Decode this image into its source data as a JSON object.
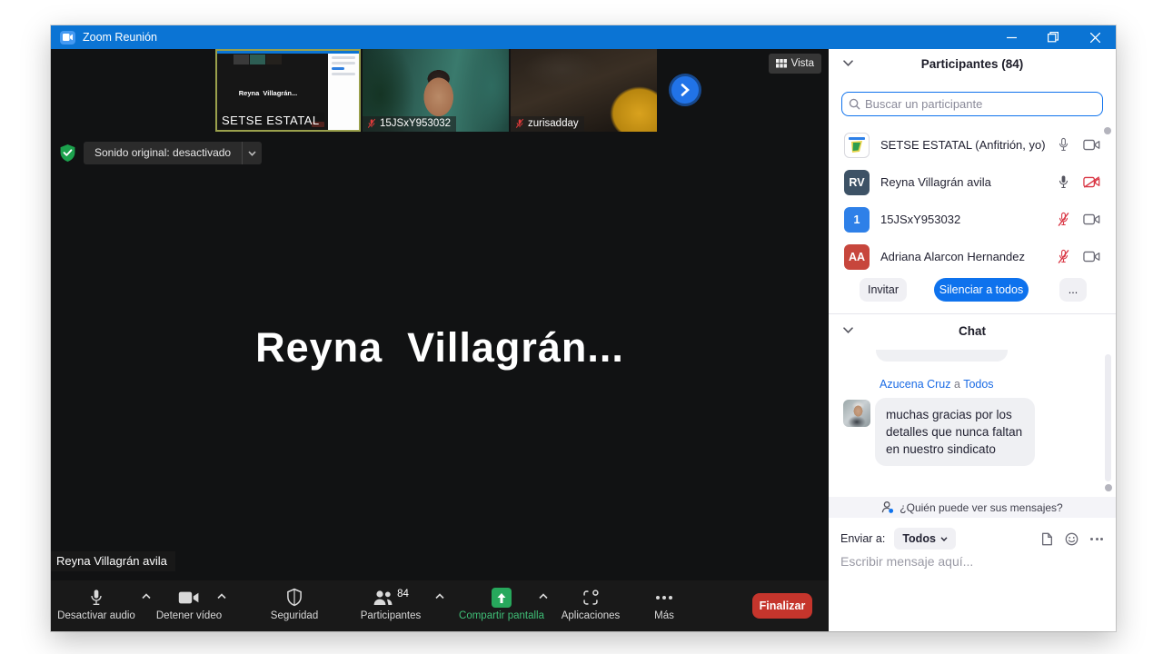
{
  "window": {
    "title": "Zoom Reunión"
  },
  "filmstrip": {
    "view_button": "Vista",
    "thumbnails": [
      {
        "label": "SETSE ESTATAL",
        "preview_name": "Reyna  Villagrán...",
        "muted": false
      },
      {
        "label": "15JSxY953032",
        "muted": true
      },
      {
        "label": "zurisadday",
        "muted": true
      }
    ]
  },
  "stage": {
    "original_sound_button": "Sonido original: desactivado",
    "speaker_display_name": "Reyna  Villagrán...",
    "speaker_name_tag": "Reyna Villagrán avila"
  },
  "toolbar": {
    "items": [
      {
        "label": "Desactivar audio",
        "icon": "mic-icon",
        "has_chevron": true
      },
      {
        "label": "Detener vídeo",
        "icon": "camera-icon",
        "has_chevron": true
      },
      {
        "label": "Seguridad",
        "icon": "shield-icon",
        "has_chevron": false
      },
      {
        "label": "Participantes",
        "icon": "people-icon",
        "badge": "84",
        "has_chevron": true
      },
      {
        "label": "Compartir pantalla",
        "icon": "share-screen-icon",
        "has_chevron": true,
        "highlight": true
      },
      {
        "label": "Aplicaciones",
        "icon": "apps-icon",
        "has_chevron": false
      },
      {
        "label": "Más",
        "icon": "ellipsis-icon",
        "has_chevron": false
      }
    ],
    "end_button": "Finalizar"
  },
  "participants": {
    "title": "Participantes (84)",
    "search_placeholder": "Buscar un participante",
    "rows": [
      {
        "name": "SETSE ESTATAL (Anfitrión, yo)",
        "avatar": "",
        "avatar_color": "#ffffff",
        "mic": "on",
        "camera": "on"
      },
      {
        "name": "Reyna Villagrán avila",
        "avatar": "RV",
        "avatar_color": "#3d5266",
        "mic": "on",
        "camera": "off"
      },
      {
        "name": "15JSxY953032",
        "avatar": "1",
        "avatar_color": "#2e80e8",
        "mic": "off",
        "camera": "on"
      },
      {
        "name": "Adriana Alarcon Hernandez",
        "avatar": "AA",
        "avatar_color": "#c7463c",
        "mic": "off",
        "camera": "on"
      }
    ],
    "invite_button": "Invitar",
    "mute_all_button": "Silenciar a todos",
    "more_button": "..."
  },
  "chat": {
    "title": "Chat",
    "message": {
      "sender": "Azucena Cruz",
      "connector": "a",
      "recipient": "Todos",
      "text": "muchas gracias por los detalles que nunca faltan en nuestro sindicato"
    },
    "privacy_note": "¿Quién puede ver sus mensajes?",
    "send_to_label": "Enviar a:",
    "send_to_value": "Todos",
    "compose_placeholder": "Escribir mensaje aquí..."
  },
  "colors": {
    "titlebar_blue": "#0b74d4",
    "accent_blue": "#0E72ED",
    "share_green": "#27a85c",
    "danger_red": "#c5352c",
    "muted_red": "#d93644"
  }
}
